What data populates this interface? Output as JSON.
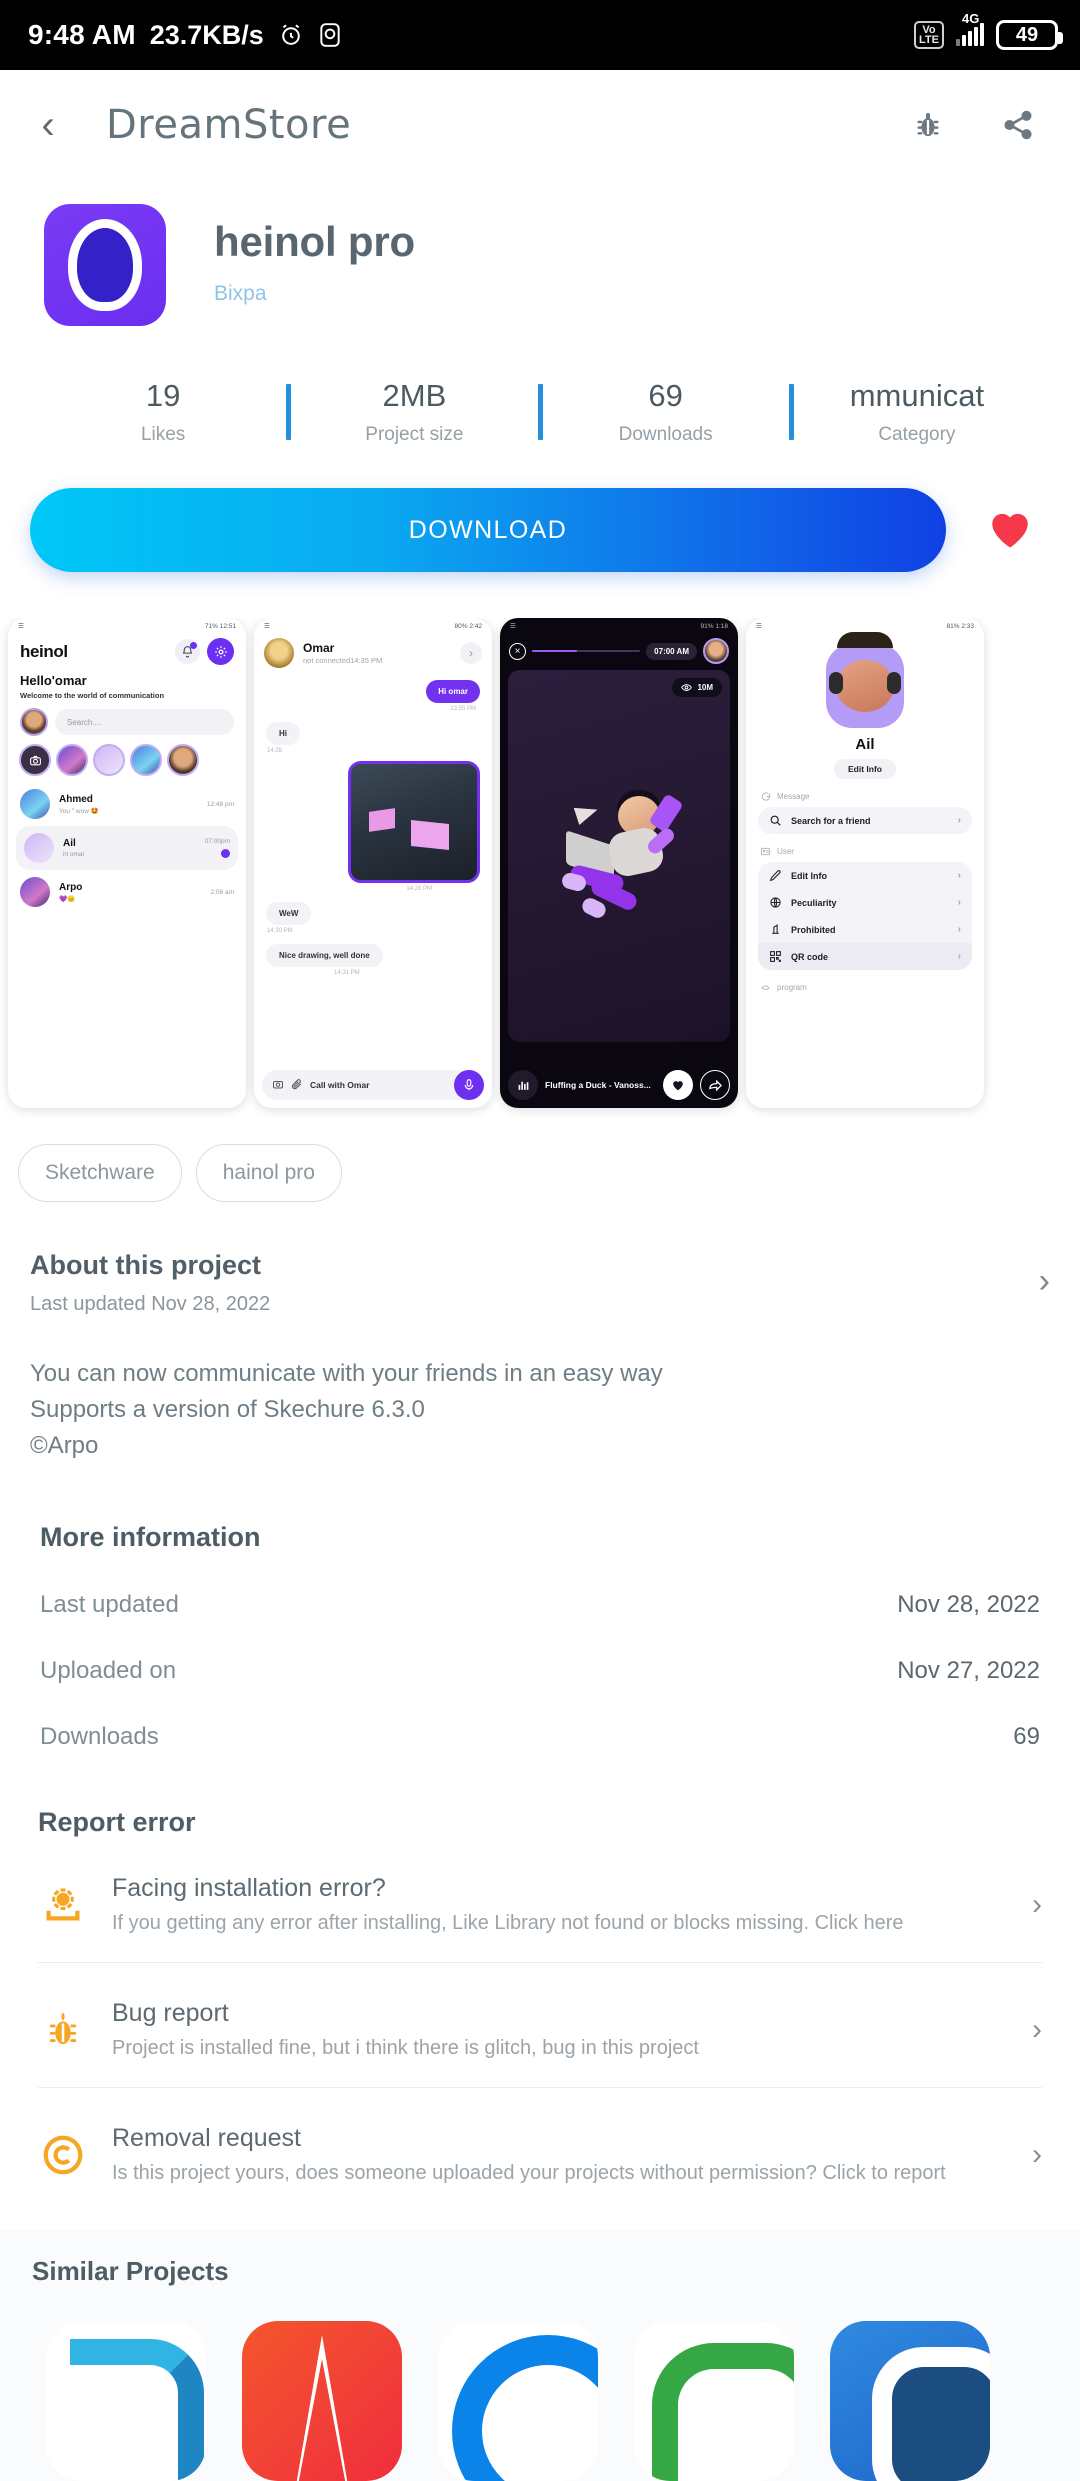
{
  "status_bar": {
    "time": "9:48 AM",
    "network_speed": "23.7KB/s",
    "alarm_icon": "alarm-clock-icon",
    "screenshot_icon": "screen-record-icon",
    "volte_label": "Vo\nLTE",
    "volte_top": "Vo",
    "volte_bottom": "LTE",
    "network_type": "4G",
    "battery_percent": "49"
  },
  "toolbar": {
    "back_icon": "back-arrow-icon",
    "title": "DreamStore",
    "bug_icon": "bug-icon",
    "share_icon": "share-icon"
  },
  "app": {
    "name": "heinol pro",
    "developer": "Bixpa",
    "icon_name": "heinol-app-icon"
  },
  "stats": [
    {
      "value": "19",
      "label": "Likes"
    },
    {
      "value": "2MB",
      "label": "Project size"
    },
    {
      "value": "69",
      "label": "Downloads"
    },
    {
      "value": "mmunicat",
      "label": "Category"
    }
  ],
  "actions": {
    "download_label": "DOWNLOAD",
    "favorite_icon": "heart-icon",
    "gradient_start": "#00c8f7",
    "gradient_end": "#1040e4",
    "heart_color": "#f5394a"
  },
  "screenshots": [
    {
      "name": "home-chat-list",
      "status": {
        "left": "signal",
        "right": "71% 12:51"
      },
      "logo": "heinol",
      "greeting": "Hello'omar",
      "subtitle": "Welcome to the world of communication",
      "search_placeholder": "Search....",
      "chats": [
        {
          "name": "Ahmed",
          "message": "You \" wow 🤩",
          "time": "12:48 pm"
        },
        {
          "name": "Ail",
          "message": "hi omar",
          "time": "07:00pm"
        },
        {
          "name": "Arpo",
          "message": "💜😑",
          "time": "2:06 am"
        }
      ]
    },
    {
      "name": "conversation-omar",
      "status": {
        "right": "80% 2:42"
      },
      "contact": "Omar",
      "contact_status": "not connected14:35 PM",
      "messages": [
        {
          "text": "Hi omar",
          "time": "13:55 PM",
          "side": "out"
        },
        {
          "text": "Hi",
          "time": "14:28",
          "side": "in"
        },
        {
          "text": "",
          "time": "14:28 PM",
          "side": "image"
        },
        {
          "text": "WeW",
          "time": "14:30 PM",
          "side": "in"
        },
        {
          "text": "Nice drawing, well done",
          "time": "14:31 PM",
          "side": "in"
        }
      ],
      "input_placeholder": "Call with Omar",
      "mic_icon": "microphone-icon",
      "camera_icon": "camera-icon",
      "attach_icon": "paperclip-icon"
    },
    {
      "name": "story-viewer",
      "status": {
        "right": "91% 1:18"
      },
      "close_icon": "close-icon",
      "timestamp": "07:00 AM",
      "views_icon": "eye-icon",
      "views": "10M",
      "song": "Fluffing a Duck - Vanoss...",
      "like_icon": "heart-icon",
      "share_icon": "share-arrow-icon",
      "equalizer_icon": "equalizer-icon"
    },
    {
      "name": "profile-settings",
      "status": {
        "right": "81% 2:33"
      },
      "username": "Ail",
      "edit_button": "Edit Info",
      "section_message": "Message",
      "search_friend": "Search for a friend",
      "section_user": "User",
      "rows": [
        {
          "label": "Edit Info",
          "icon": "pencil-icon"
        },
        {
          "label": "Peculiarity",
          "icon": "globe-icon"
        },
        {
          "label": "Prohibited",
          "icon": "block-icon"
        },
        {
          "label": "QR code",
          "icon": "qr-code-icon"
        }
      ],
      "section_program": "program"
    }
  ],
  "tags": [
    {
      "label": "Sketchware"
    },
    {
      "label": "hainol pro"
    }
  ],
  "about": {
    "heading": "About this project",
    "last_updated": "Last updated Nov 28, 2022",
    "chevron_icon": "chevron-right-icon",
    "description_line1": "You can now communicate with your friends in an easy way",
    "description_line2": "Supports a version of Skechure 6.3.0",
    "description_line3": "©Arpo"
  },
  "more_information": {
    "heading": "More information",
    "rows": [
      {
        "key": "Last updated",
        "value": "Nov 28, 2022"
      },
      {
        "key": "Uploaded on",
        "value": "Nov 27, 2022"
      },
      {
        "key": "Downloads",
        "value": "69"
      }
    ]
  },
  "report_error": {
    "heading": "Report error",
    "items": [
      {
        "title": "Facing installation error?",
        "description": "If you getting any error after installing, Like Library not found or blocks missing. Click here",
        "icon": "install-error-gear-icon",
        "icon_color": "#f5a623"
      },
      {
        "title": "Bug report",
        "description": "Project is installed fine, but i think there is glitch, bug in this project",
        "icon": "bug-icon",
        "icon_color": "#f5a623"
      },
      {
        "title": "Removal request",
        "description": "Is this project yours, does someone uploaded your projects without permission? Click to report",
        "icon": "copyright-icon",
        "icon_color": "#f5a623"
      }
    ]
  },
  "similar_projects": {
    "heading": "Similar Projects",
    "items": [
      {
        "name": "similar-app-1",
        "color": "#1f86c4"
      },
      {
        "name": "similar-app-2",
        "color": "#ef2e3e"
      },
      {
        "name": "similar-app-3",
        "color": "#0a84e8"
      },
      {
        "name": "similar-app-4",
        "color": "#35a745"
      },
      {
        "name": "similar-app-5",
        "color": "#1f66c9"
      }
    ]
  }
}
